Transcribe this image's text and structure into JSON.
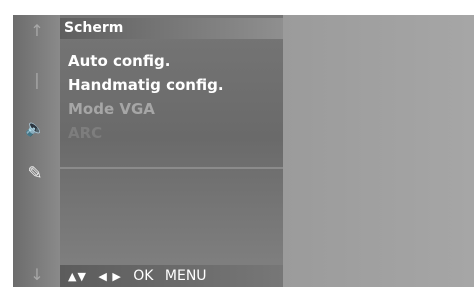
{
  "side_icons": [
    {
      "icon": "arrow-up-icon",
      "glyph": "↑"
    },
    {
      "icon": "separator-icon",
      "glyph": "|"
    },
    {
      "icon": "speaker-icon",
      "glyph": "🔈"
    },
    {
      "icon": "satellite-dish-icon",
      "glyph": "✎"
    },
    {
      "icon": "arrow-down-icon",
      "glyph": "↓"
    }
  ],
  "menu": {
    "title": "Scherm",
    "items": [
      {
        "label": "Auto config.",
        "state": "enabled"
      },
      {
        "label": "Handmatig config.",
        "state": "enabled"
      },
      {
        "label": "Mode VGA",
        "state": "disabled"
      },
      {
        "label": "ARC",
        "state": "faded"
      }
    ]
  },
  "help_bar": {
    "updown": "▲▼",
    "leftright": "◀ ▶",
    "ok": "OK",
    "menu": "MENU"
  }
}
